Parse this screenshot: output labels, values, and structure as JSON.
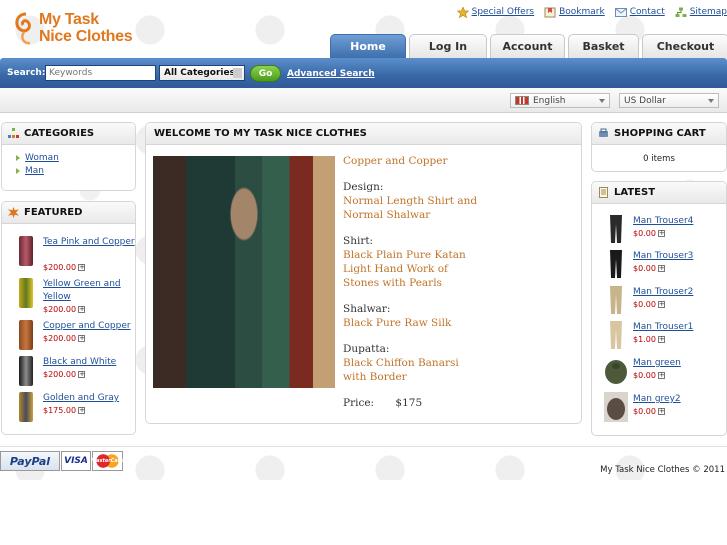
{
  "brand": {
    "line1": "My Task",
    "line2": "Nice Clothes"
  },
  "top_links": [
    {
      "label": "Special Offers",
      "icon": "star-icon"
    },
    {
      "label": "Bookmark",
      "icon": "bookmark-icon"
    },
    {
      "label": "Contact",
      "icon": "envelope-icon"
    },
    {
      "label": "Sitemap",
      "icon": "sitemap-icon"
    }
  ],
  "tabs": [
    "Home",
    "Log In",
    "Account",
    "Basket",
    "Checkout"
  ],
  "search": {
    "label": "Search:",
    "placeholder": "Keywords",
    "category_selected": "All Categories",
    "go_label": "Go",
    "advanced_label": "Advanced Search"
  },
  "locale": {
    "language": "English",
    "currency": "US Dollar"
  },
  "categories": {
    "title": "CATEGORIES",
    "items": [
      "Woman",
      "Man"
    ]
  },
  "featured": {
    "title": "FEATURED",
    "items": [
      {
        "name": "Tea Pink and Copper",
        "price": "$200.00"
      },
      {
        "name": "Yellow Green and Yellow",
        "price": "$200.00"
      },
      {
        "name": "Copper and Copper",
        "price": "$200.00"
      },
      {
        "name": "Black and White",
        "price": "$200.00"
      },
      {
        "name": "Golden and Gray",
        "price": "$175.00"
      }
    ]
  },
  "welcome": {
    "title": "WELCOME TO MY TASK NICE CLOTHES",
    "product_title": "Copper and Copper",
    "design_label": "Design:",
    "design": [
      "Normal Length Shirt and",
      "Normal Shalwar"
    ],
    "shirt_label": "Shirt:",
    "shirt": [
      "Black Plain Pure Katan",
      "Light Hand Work of",
      "Stones with Pearls"
    ],
    "shalwar_label": "Shalwar:",
    "shalwar": [
      "Black Pure Raw Silk"
    ],
    "dupatta_label": "Dupatta:",
    "dupatta": [
      "Black Chiffon Banarsi",
      "with Border"
    ],
    "price_label": "Price:",
    "price": "$175"
  },
  "cart": {
    "title": "SHOPPING CART",
    "status": "0 items"
  },
  "latest": {
    "title": "LATEST",
    "items": [
      {
        "name": "Man Trouser4",
        "price": "$0.00"
      },
      {
        "name": "Man Trouser3",
        "price": "$0.00"
      },
      {
        "name": "Man Trouser2",
        "price": "$0.00"
      },
      {
        "name": "Man Trouser1",
        "price": "$1.00"
      },
      {
        "name": "Man green",
        "price": "$0.00"
      },
      {
        "name": "Man grey2",
        "price": "$0.00"
      }
    ]
  },
  "payments": [
    "PayPal",
    "VISA",
    "MasterCard"
  ],
  "copyright": "My Task Nice Clothes © 2011",
  "colors": {
    "primary_blue": "#3d6fae",
    "accent_orange": "#e0781d",
    "go_green": "#5aa825",
    "price_red": "#b00000"
  }
}
